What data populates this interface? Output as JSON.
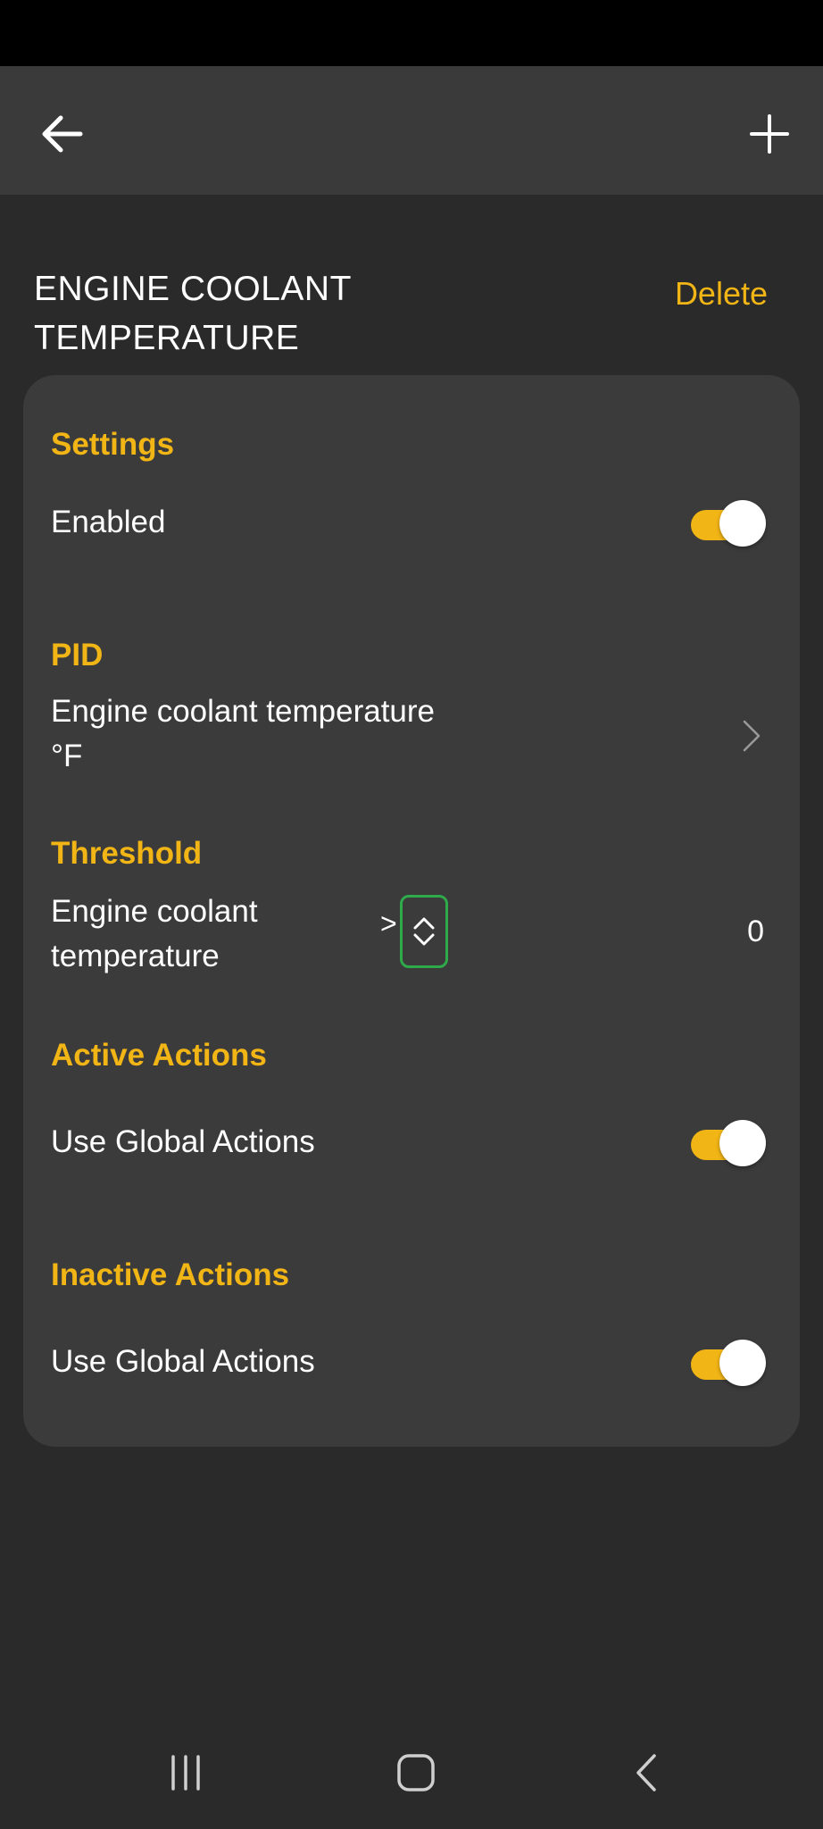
{
  "header": {
    "back_icon": "arrow-left-icon",
    "add_icon": "plus-icon"
  },
  "page": {
    "title": "ENGINE COOLANT\nTEMPERATURE",
    "delete_label": "Delete"
  },
  "settings": {
    "title": "Settings",
    "enabled_label": "Enabled",
    "enabled": true
  },
  "pid": {
    "title": "PID",
    "name": "Engine coolant temperature",
    "unit": "°F"
  },
  "threshold": {
    "title": "Threshold",
    "label": "Engine coolant temperature",
    "operator": ">",
    "value": "0"
  },
  "active_actions": {
    "title": "Active Actions",
    "label": "Use Global Actions",
    "enabled": true
  },
  "inactive_actions": {
    "title": "Inactive Actions",
    "label": "Use Global Actions",
    "enabled": true
  },
  "colors": {
    "accent": "#f2b516",
    "card": "#3b3b3b",
    "background": "#2a2a2a",
    "stepper_border": "#2faa4a"
  },
  "nav": {
    "recents_icon": "recents-icon",
    "home_icon": "home-icon",
    "back_icon": "nav-back-icon"
  }
}
